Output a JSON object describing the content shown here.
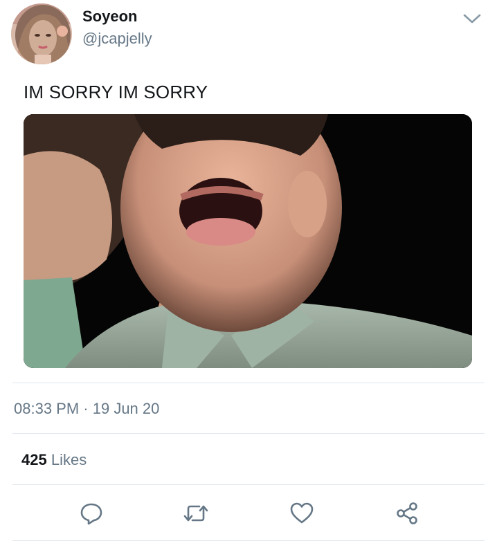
{
  "tweet": {
    "author_name": "Soyeon",
    "author_handle": "@jcapjelly",
    "text": "IM SORRY IM SORRY",
    "time": "08:33 PM",
    "separator": " · ",
    "date": "19 Jun 20",
    "likes_count": "425",
    "likes_label": "Likes"
  },
  "icons": {
    "menu": "chevron-down-icon",
    "reply": "reply-icon",
    "retweet": "retweet-icon",
    "like": "heart-icon",
    "share": "share-icon"
  },
  "colors": {
    "primary_text": "#14171a",
    "secondary_text": "#657786",
    "divider": "#e1e8ed",
    "icon": "#657786"
  }
}
